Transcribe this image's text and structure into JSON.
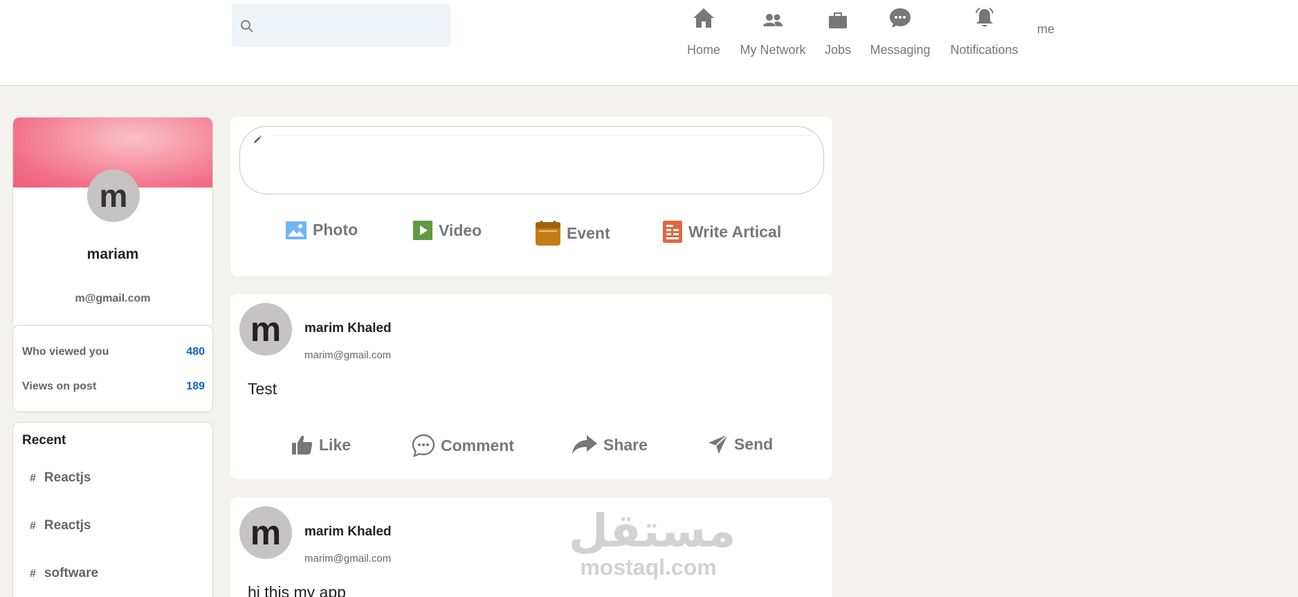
{
  "search": {
    "placeholder": ""
  },
  "nav": {
    "items": [
      {
        "label": "Home",
        "icon": "home-icon"
      },
      {
        "label": "My Network",
        "icon": "network-icon"
      },
      {
        "label": "Jobs",
        "icon": "briefcase-icon"
      },
      {
        "label": "Messaging",
        "icon": "chat-icon"
      },
      {
        "label": "Notifications",
        "icon": "bell-icon"
      }
    ],
    "me_label": "me"
  },
  "profile": {
    "avatar_letter": "m",
    "name": "mariam",
    "email": "m@gmail.com"
  },
  "stats": [
    {
      "label": "Who viewed you",
      "value": "480"
    },
    {
      "label": "Views on post",
      "value": "189"
    }
  ],
  "recent": {
    "title": "Recent",
    "items": [
      {
        "hash": "#",
        "label": "Reactjs"
      },
      {
        "hash": "#",
        "label": "Reactjs"
      },
      {
        "hash": "#",
        "label": "software"
      }
    ]
  },
  "composer": {
    "placeholder": "",
    "buttons": [
      {
        "label": "Photo",
        "icon": "photo-icon",
        "color": "#70b5f9"
      },
      {
        "label": "Video",
        "icon": "video-icon",
        "color": "#5f9b41"
      },
      {
        "label": "Event",
        "icon": "calendar-icon",
        "color": "#c37d16"
      },
      {
        "label": "Write Artical",
        "icon": "article-icon",
        "color": "#e16745"
      }
    ]
  },
  "posts": [
    {
      "avatar_letter": "m",
      "author": "marim Khaled",
      "email": "marim@gmail.com",
      "text": "Test",
      "actions": [
        {
          "label": "Like",
          "icon": "thumbs-up-icon"
        },
        {
          "label": "Comment",
          "icon": "comment-icon"
        },
        {
          "label": "Share",
          "icon": "share-icon"
        },
        {
          "label": "Send",
          "icon": "send-icon"
        }
      ]
    },
    {
      "avatar_letter": "m",
      "author": "marim Khaled",
      "email": "marim@gmail.com",
      "text": "hi this my app"
    }
  ],
  "watermark": {
    "arabic": "مستقل",
    "latin": "mostaql.com"
  },
  "colors": {
    "link_blue": "#0a66c2",
    "background": "#f3f2ef",
    "icon_gray": "#777777"
  }
}
